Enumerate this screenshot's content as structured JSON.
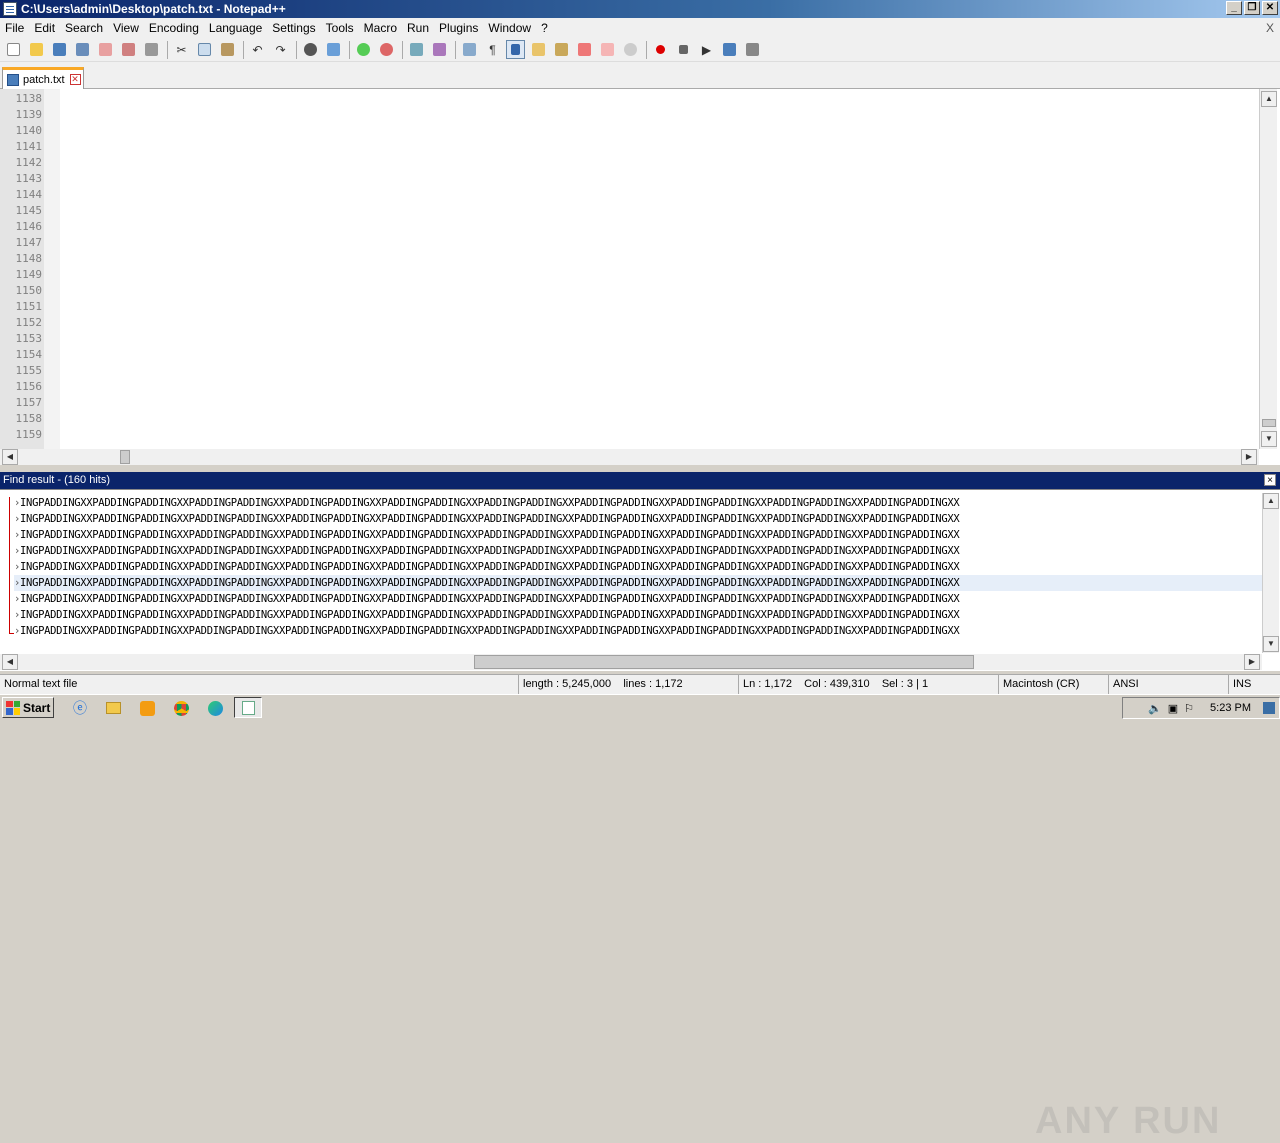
{
  "window": {
    "title": "C:\\Users\\admin\\Desktop\\patch.txt - Notepad++"
  },
  "menu": [
    "File",
    "Edit",
    "Search",
    "View",
    "Encoding",
    "Language",
    "Settings",
    "Tools",
    "Macro",
    "Run",
    "Plugins",
    "Window",
    "?"
  ],
  "menu_close": "X",
  "toolbar_icons": [
    "new-file-icon",
    "open-file-icon",
    "save-icon",
    "save-all-icon",
    "close-icon",
    "close-all-icon",
    "print-icon",
    "cut-icon",
    "copy-icon",
    "paste-icon",
    "undo-icon",
    "redo-icon",
    "find-icon",
    "replace-icon",
    "zoom-in-icon",
    "zoom-out-icon",
    "sync-vertical-icon",
    "sync-horizontal-icon",
    "word-wrap-icon",
    "show-all-chars-icon",
    "indent-guide-icon",
    "doc-map-icon",
    "function-list-icon",
    "folder-workspace-icon",
    "monitoring-icon",
    "record-macro-icon",
    "stop-record-icon",
    "play-macro-icon",
    "run-macro-multiple-icon",
    "save-macro-icon"
  ],
  "tab": {
    "label": "patch.txt"
  },
  "editor": {
    "line_numbers": [
      "1138",
      "1139",
      "1140",
      "1141",
      "1142",
      "1143",
      "1144",
      "1145",
      "1146",
      "1147",
      "1148",
      "1149",
      "1150",
      "1151",
      "1152",
      "1153",
      "1154",
      "1155",
      "1156",
      "1157",
      "1158",
      "1159"
    ]
  },
  "find_result": {
    "title": "Find result - (160 hits)",
    "rows": [
      "INGPADDINGXXPADDINGPADDINGXXPADDINGPADDINGXXPADDINGPADDINGXXPADDINGPADDINGXXPADDINGPADDINGXXPADDINGPADDINGXXPADDINGPADDINGXXPADDINGPADDINGXXPADDINGPADDINGXX",
      "INGPADDINGXXPADDINGPADDINGXXPADDINGPADDINGXXPADDINGPADDINGXXPADDINGPADDINGXXPADDINGPADDINGXXPADDINGPADDINGXXPADDINGPADDINGXXPADDINGPADDINGXXPADDINGPADDINGXX",
      "INGPADDINGXXPADDINGPADDINGXXPADDINGPADDINGXXPADDINGPADDINGXXPADDINGPADDINGXXPADDINGPADDINGXXPADDINGPADDINGXXPADDINGPADDINGXXPADDINGPADDINGXXPADDINGPADDINGXX",
      "INGPADDINGXXPADDINGPADDINGXXPADDINGPADDINGXXPADDINGPADDINGXXPADDINGPADDINGXXPADDINGPADDINGXXPADDINGPADDINGXXPADDINGPADDINGXXPADDINGPADDINGXXPADDINGPADDINGXX",
      "INGPADDINGXXPADDINGPADDINGXXPADDINGPADDINGXXPADDINGPADDINGXXPADDINGPADDINGXXPADDINGPADDINGXXPADDINGPADDINGXXPADDINGPADDINGXXPADDINGPADDINGXXPADDINGPADDINGXX",
      "INGPADDINGXXPADDINGPADDINGXXPADDINGPADDINGXXPADDINGPADDINGXXPADDINGPADDINGXXPADDINGPADDINGXXPADDINGPADDINGXXPADDINGPADDINGXXPADDINGPADDINGXXPADDINGPADDINGXX",
      "INGPADDINGXXPADDINGPADDINGXXPADDINGPADDINGXXPADDINGPADDINGXXPADDINGPADDINGXXPADDINGPADDINGXXPADDINGPADDINGXXPADDINGPADDINGXXPADDINGPADDINGXXPADDINGPADDINGXX",
      "INGPADDINGXXPADDINGPADDINGXXPADDINGPADDINGXXPADDINGPADDINGXXPADDINGPADDINGXXPADDINGPADDINGXXPADDINGPADDINGXXPADDINGPADDINGXXPADDINGPADDINGXXPADDINGPADDINGXX",
      "INGPADDINGXXPADDINGPADDINGXXPADDINGPADDINGXXPADDINGPADDINGXXPADDINGPADDINGXXPADDINGPADDINGXXPADDINGPADDINGXXPADDINGPADDINGXXPADDINGPADDINGXXPADDINGPADDINGXX"
    ],
    "highlighted_row": 5,
    "close_label": "×"
  },
  "statusbar": {
    "filetype": "Normal text file",
    "length": "length : 5,245,000",
    "lines": "lines : 1,172",
    "position": "Ln : 1,172    Col : 439,310    Sel : 3 | 1",
    "eol": "Macintosh (CR)",
    "encoding": "ANSI",
    "mode": "INS"
  },
  "taskbar": {
    "start_label": "Start",
    "apps": [
      "internet-explorer-icon",
      "file-explorer-icon",
      "media-player-icon",
      "chrome-icon",
      "edge-icon",
      "notepadpp-icon"
    ],
    "clock": "5:23 PM"
  },
  "watermark": "ANY RUN"
}
